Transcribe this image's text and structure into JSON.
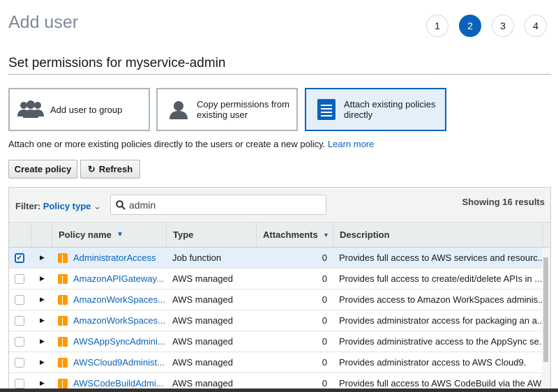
{
  "header": {
    "title": "Add user",
    "steps": [
      "1",
      "2",
      "3",
      "4"
    ],
    "active_step": 2
  },
  "subtitle": "Set permissions for myservice-admin",
  "options": [
    {
      "label": "Add user to group",
      "icon": "group-icon",
      "selected": false
    },
    {
      "label": "Copy permissions from existing user",
      "icon": "user-icon",
      "selected": false
    },
    {
      "label": "Attach existing policies directly",
      "icon": "document-icon",
      "selected": true
    }
  ],
  "info": {
    "text": "Attach one or more existing policies directly to the users or create a new policy. ",
    "link": "Learn more"
  },
  "buttons": {
    "create": "Create policy",
    "refresh": "Refresh"
  },
  "filter": {
    "label": "Filter:",
    "value": "Policy type",
    "search": "admin",
    "count": "Showing 16 results"
  },
  "columns": [
    "Policy name",
    "Type",
    "Attachments",
    "Description"
  ],
  "rows": [
    {
      "checked": true,
      "name": "AdministratorAccess",
      "type": "Job function",
      "attachments": "0",
      "description": "Provides full access to AWS services and resourc..."
    },
    {
      "checked": false,
      "name": "AmazonAPIGateway...",
      "type": "AWS managed",
      "attachments": "0",
      "description": "Provides full access to create/edit/delete APIs in ..."
    },
    {
      "checked": false,
      "name": "AmazonWorkSpaces...",
      "type": "AWS managed",
      "attachments": "0",
      "description": "Provides access to Amazon WorkSpaces adminis..."
    },
    {
      "checked": false,
      "name": "AmazonWorkSpaces...",
      "type": "AWS managed",
      "attachments": "0",
      "description": "Provides administrator access for packaging an a..."
    },
    {
      "checked": false,
      "name": "AWSAppSyncAdmini...",
      "type": "AWS managed",
      "attachments": "0",
      "description": "Provides administrative access to the AppSync se..."
    },
    {
      "checked": false,
      "name": "AWSCloud9Administ...",
      "type": "AWS managed",
      "attachments": "0",
      "description": "Provides administrator access to AWS Cloud9."
    },
    {
      "checked": false,
      "name": "AWSCodeBuildAdmi...",
      "type": "AWS managed",
      "attachments": "0",
      "description": "Provides full access to AWS CodeBuild via the AW..."
    }
  ],
  "colors": {
    "accent": "#0a63b8",
    "policy_icon": "#ff9900",
    "selected_row": "#e4effa"
  }
}
